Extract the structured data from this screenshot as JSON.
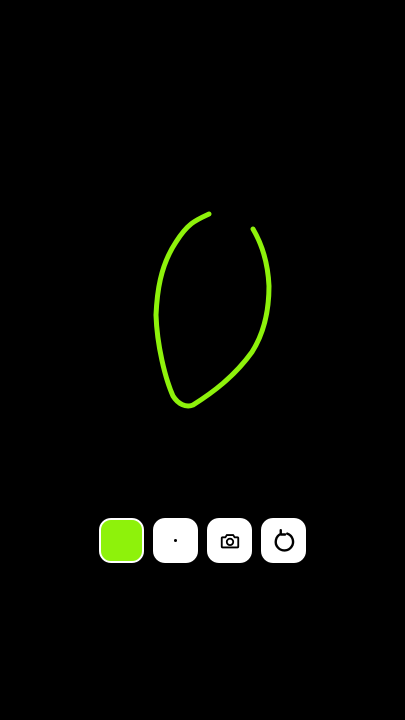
{
  "canvas": {
    "background": "#000000",
    "stroke_color": "#8ef20b",
    "strokes": 1
  },
  "toolbar": {
    "color_swatch": "#8ef20b",
    "brush_size": "small",
    "tools": [
      "color-swatch",
      "brush-size",
      "camera-icon",
      "undo-icon"
    ]
  }
}
